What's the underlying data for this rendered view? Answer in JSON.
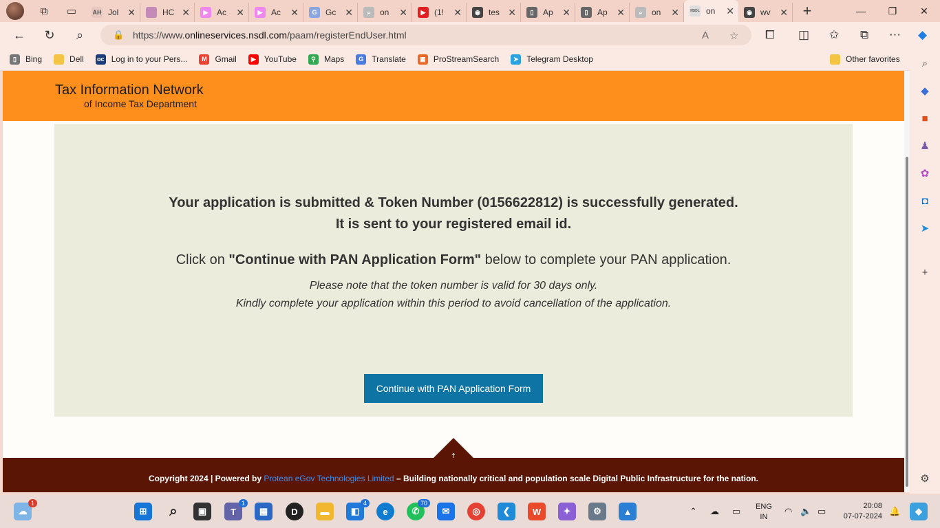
{
  "browser": {
    "tabs": [
      {
        "title": "Jol",
        "favicon": "AH"
      },
      {
        "title": "HC",
        "favicon": "image-icon"
      },
      {
        "title": "Ac",
        "favicon": "play-arrow-icon"
      },
      {
        "title": "Ac",
        "favicon": "play-arrow-icon"
      },
      {
        "title": "Gc",
        "favicon": "translate-icon"
      },
      {
        "title": "on",
        "favicon": "search-icon"
      },
      {
        "title": "(1!",
        "favicon": "youtube-icon"
      },
      {
        "title": "tes",
        "favicon": "page-icon"
      },
      {
        "title": "Ap",
        "favicon": "document-icon"
      },
      {
        "title": "Ap",
        "favicon": "document-icon"
      },
      {
        "title": "on",
        "favicon": "search-icon"
      },
      {
        "title": "on",
        "favicon": "NSDL"
      },
      {
        "title": "wv",
        "favicon": "page-icon"
      }
    ],
    "address": {
      "prefix": "https://www.",
      "domain": "onlineservices.nsdl.com",
      "path": "/paam/registerEndUser.html"
    },
    "favorites": [
      {
        "label": "Bing"
      },
      {
        "label": "Dell"
      },
      {
        "label": "Log in to your Pers..."
      },
      {
        "label": "Gmail"
      },
      {
        "label": "YouTube"
      },
      {
        "label": "Maps"
      },
      {
        "label": "Translate"
      },
      {
        "label": "ProStreamSearch"
      },
      {
        "label": "Telegram Desktop"
      }
    ],
    "other_favorites": "Other favorites"
  },
  "site": {
    "brand_line1": "Tax Information Network",
    "brand_line2": "of Income Tax Department",
    "message_line1": "Your application is submitted & Token Number (0156622812) is successfully generated.",
    "message_line2": "It is sent to your registered email id.",
    "instruction_prefix": "Click on ",
    "instruction_quoted": "\"Continue with PAN Application Form\"",
    "instruction_suffix": " below to complete your PAN application.",
    "note_line1": "Please note that the token number is valid for 30 days only.",
    "note_line2": "Kindly complete your application within this period to avoid cancellation of the application.",
    "continue_button": "Continue with PAN Application Form",
    "footer_prefix": "Copyright 2024 | Powered by ",
    "footer_link": "Protean eGov Technologies Limited",
    "footer_suffix": " – Building nationally critical and population scale Digital Public Infrastructure for the nation.",
    "colors": {
      "header": "#fe8f1c",
      "panel": "#ebecdc",
      "button": "#0e74a3",
      "footer": "#5a1505"
    }
  },
  "taskbar": {
    "weather_badge": "1",
    "teams_badge": "1",
    "store_badge": "4",
    "whatsapp_badge": "70",
    "lang_line1": "ENG",
    "lang_line2": "IN",
    "time": "20:08",
    "date": "07-07-2024"
  }
}
